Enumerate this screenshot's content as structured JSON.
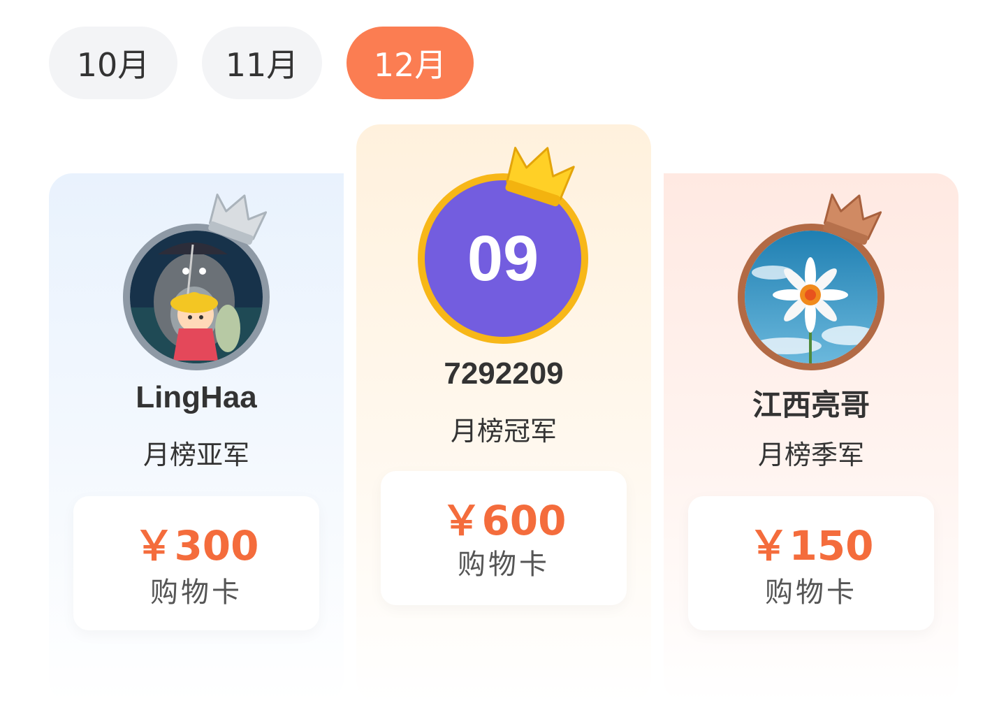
{
  "tabs": [
    {
      "label": "10月",
      "active": false
    },
    {
      "label": "11月",
      "active": false
    },
    {
      "label": "12月",
      "active": true
    }
  ],
  "podium": {
    "first": {
      "name": "7292209",
      "rank_label": "月榜冠军",
      "avatar_text": "09",
      "avatar_color": "#735ddf",
      "ring_color": "#f7b718",
      "crown": "gold-crown-icon",
      "prize_amount": "￥600",
      "prize_label": "购物卡"
    },
    "second": {
      "name": "LingHaa",
      "rank_label": "月榜亚军",
      "avatar": "cartoon-girl-totoro-avatar",
      "ring_color": "#8e99a5",
      "crown": "silver-crown-icon",
      "prize_amount": "￥300",
      "prize_label": "购物卡"
    },
    "third": {
      "name": "江西亮哥",
      "rank_label": "月榜季军",
      "avatar": "daisy-sky-avatar",
      "ring_color": "#b26a45",
      "crown": "bronze-crown-icon",
      "prize_amount": "￥150",
      "prize_label": "购物卡"
    }
  },
  "colors": {
    "accent": "#fb7d52",
    "prize_text": "#f46c3c"
  }
}
